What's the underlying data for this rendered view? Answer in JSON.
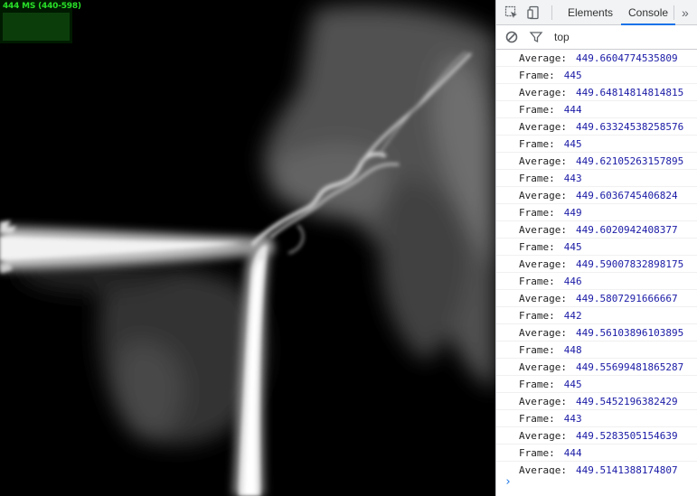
{
  "stats": {
    "text": "444 MS (440-598)"
  },
  "devtools": {
    "tabs": [
      "Elements",
      "Console"
    ],
    "active_tab": "Console",
    "more_tabs_glyph": "»",
    "context": "top",
    "prompt_glyph": "›",
    "icons": [
      "inspect-element-icon",
      "device-toolbar-icon",
      "clear-console-icon",
      "filter-icon"
    ],
    "log": [
      {
        "label": "Average:",
        "value": "449.6604774535809"
      },
      {
        "label": "Frame:",
        "value": "445"
      },
      {
        "label": "Average:",
        "value": "449.64814814814815"
      },
      {
        "label": "Frame:",
        "value": "444"
      },
      {
        "label": "Average:",
        "value": "449.63324538258576"
      },
      {
        "label": "Frame:",
        "value": "445"
      },
      {
        "label": "Average:",
        "value": "449.62105263157895"
      },
      {
        "label": "Frame:",
        "value": "443"
      },
      {
        "label": "Average:",
        "value": "449.6036745406824"
      },
      {
        "label": "Frame:",
        "value": "449"
      },
      {
        "label": "Average:",
        "value": "449.6020942408377"
      },
      {
        "label": "Frame:",
        "value": "445"
      },
      {
        "label": "Average:",
        "value": "449.59007832898175"
      },
      {
        "label": "Frame:",
        "value": "446"
      },
      {
        "label": "Average:",
        "value": "449.5807291666667"
      },
      {
        "label": "Frame:",
        "value": "442"
      },
      {
        "label": "Average:",
        "value": "449.56103896103895"
      },
      {
        "label": "Frame:",
        "value": "448"
      },
      {
        "label": "Average:",
        "value": "449.55699481865287"
      },
      {
        "label": "Frame:",
        "value": "445"
      },
      {
        "label": "Average:",
        "value": "449.5452196382429"
      },
      {
        "label": "Frame:",
        "value": "443"
      },
      {
        "label": "Average:",
        "value": "449.5283505154639"
      },
      {
        "label": "Frame:",
        "value": "444"
      },
      {
        "label": "Average:",
        "value": "449.5141388174807"
      }
    ]
  },
  "colors": {
    "stats_text": "#28e028",
    "log_value": "#1a1aa6",
    "active_tab_underline": "#1a73e8"
  }
}
